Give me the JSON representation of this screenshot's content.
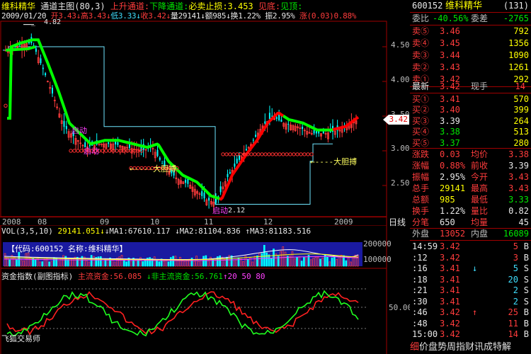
{
  "stock": {
    "name": "维科精华",
    "code": "600152",
    "code_paren": "(131)"
  },
  "main_chart": {
    "title": "维科精华",
    "indicator": "通道主图(80,3)",
    "up_channel": "上升通道:",
    "down_channel": "下降通道:",
    "stop_loss": "必卖止损:3.453",
    "bottom": "见底:",
    "top": "见顶:",
    "info_line": {
      "date": "2009/01/20",
      "open": "开3.43",
      "high": "高3.43",
      "low": "低3.33",
      "close": "收3.42",
      "volume": "量29141",
      "amount": "额985",
      "turnover": "换1.22%",
      "amplitude": "振2.95%",
      "change": "涨(0.03)0.88%"
    },
    "peak_label": "4.82",
    "low_label": "2.12",
    "current_price_label": "3.42",
    "annotations": [
      "启动",
      "启动",
      "大胆搏",
      "大胆搏",
      "启动"
    ],
    "y_ticks": [
      "4.50",
      "4.00",
      "3.50",
      "3.00",
      "2.50"
    ],
    "x_labels": [
      "2008",
      "08",
      "09",
      "10",
      "11",
      "12",
      "2009"
    ],
    "period_label": "日线",
    "colors": {
      "candle_up": "#ff3c3c",
      "candle_down": "#00ffff",
      "ma_up": "#ff0000",
      "ma_down": "#00ff00",
      "band": "#6fe6ff"
    }
  },
  "volume_chart": {
    "label": "VOL(3,5,10)",
    "vol": "29141.051",
    "ma1": "↓MA1:67610.117",
    "ma2": "↓MA2:81104.836",
    "ma3": "↑MA3:81183.516",
    "ma3_arrow": "↓",
    "overlay": "【代码:600152 名称:维科精华】",
    "y_ticks": [
      "200000",
      "100000"
    ]
  },
  "fund_chart": {
    "label": "资金指数(副图指标)",
    "main_fund": "主流资金:56.085",
    "non_main_fund": "↓非主流资金:56.761",
    "levels_text": "↑20  50  80",
    "y_tick": "50.00",
    "footer": "飞狐交易师"
  },
  "quote_panel": {
    "ratio_label": "委比",
    "ratio_value": "-40.56%",
    "diff_label": "委差",
    "diff_value": "-2765",
    "sell": [
      {
        "label": "卖⑤",
        "price": "3.46",
        "vol": "792"
      },
      {
        "label": "卖④",
        "price": "3.45",
        "vol": "1356"
      },
      {
        "label": "卖③",
        "price": "3.44",
        "vol": "1090"
      },
      {
        "label": "卖②",
        "price": "3.43",
        "vol": "1261"
      },
      {
        "label": "卖①",
        "price": "3.42",
        "vol": "292"
      }
    ],
    "last_label": "最新",
    "last_price": "3.42",
    "now_hand_label": "现手",
    "now_hand": "14",
    "buy": [
      {
        "label": "买①",
        "price": "3.41",
        "vol": "570"
      },
      {
        "label": "买②",
        "price": "3.40",
        "vol": "399"
      },
      {
        "label": "买③",
        "price": "3.39",
        "vol": "264"
      },
      {
        "label": "买④",
        "price": "3.38",
        "vol": "513"
      },
      {
        "label": "买⑤",
        "price": "3.37",
        "vol": "280"
      }
    ],
    "stats": [
      {
        "l1": "涨跌",
        "v1": "0.03",
        "l2": "均价",
        "v2": "3.38"
      },
      {
        "l1": "涨幅",
        "v1": "0.88%",
        "l2": "前收",
        "v2": "3.39"
      },
      {
        "l1": "振幅",
        "v1": "2.95%",
        "l2": "今开",
        "v2": "3.43"
      },
      {
        "l1": "总手",
        "v1": "29141",
        "l2": "最高",
        "v2": "3.43"
      },
      {
        "l1": "总额",
        "v1": "985",
        "l2": "最低",
        "v2": "3.33"
      },
      {
        "l1": "换手",
        "v1": "1.22%",
        "l2": "量比",
        "v2": "0.82"
      },
      {
        "l1": "分笔",
        "v1": "650",
        "l2": "均量",
        "v2": "45"
      }
    ],
    "outer_label": "外盘",
    "outer_value": "13052",
    "inner_label": "内盘",
    "inner_value": "16089",
    "ticks": [
      {
        "time": "14:59",
        "price": "3.42",
        "arrow": "",
        "vol": "5",
        "side": "B"
      },
      {
        "time": ":12",
        "price": "3.42",
        "arrow": "",
        "vol": "3",
        "side": "B"
      },
      {
        "time": ":16",
        "price": "3.41",
        "arrow": "↓",
        "vol": "5",
        "side": "S"
      },
      {
        "time": ":18",
        "price": "3.41",
        "arrow": "",
        "vol": "20",
        "side": "S"
      },
      {
        "time": ":21",
        "price": "3.41",
        "arrow": "",
        "vol": "2",
        "side": "S"
      },
      {
        "time": ":30",
        "price": "3.41",
        "arrow": "",
        "vol": "2",
        "side": "S"
      },
      {
        "time": ":46",
        "price": "3.42",
        "arrow": "↑",
        "vol": "25",
        "side": "B"
      },
      {
        "time": ":48",
        "price": "3.42",
        "arrow": "",
        "vol": "11",
        "side": "B"
      },
      {
        "time": "15:00",
        "price": "3.42",
        "arrow": "",
        "vol": "14",
        "side": "B"
      }
    ],
    "bottom_tabs": "细价盘势周指财讯成特解"
  }
}
